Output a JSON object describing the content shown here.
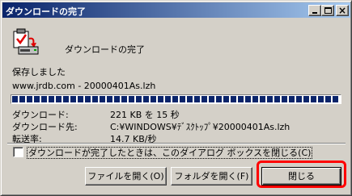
{
  "window": {
    "title": "ダウンロードの完了",
    "min_glyph": "",
    "max_glyph": "",
    "close_glyph": "×"
  },
  "heading": "ダウンロードの完了",
  "status": "保存しました",
  "file": "www.jrdb.com - 20000401As.lzh",
  "progress": {
    "fraction": 1.0
  },
  "details": [
    {
      "label": "ダウンロード:",
      "value": "221 KB を 15 秒"
    },
    {
      "label": "ダウンロード先:",
      "value": "C:¥WINDOWS¥ﾃﾞｽｸﾄｯﾌﾟ¥20000401As.lzh"
    },
    {
      "label": "転送率:",
      "value": "14.7 KB/秒"
    }
  ],
  "checkbox": {
    "label": "ダウンロードが完了したときは、このダイアログ ボックスを閉じる(C)",
    "checked": false
  },
  "buttons": {
    "open_file": "ファイルを開く(O)",
    "open_folder": "フォルダを開く(F)",
    "close": "閉じる"
  },
  "colors": {
    "title_start": "#0a246a",
    "title_end": "#a6caf0",
    "annotation": "#ff0000"
  },
  "icons": [
    "download-complete-icon",
    "minimize-icon",
    "maximize-icon",
    "close-icon"
  ]
}
